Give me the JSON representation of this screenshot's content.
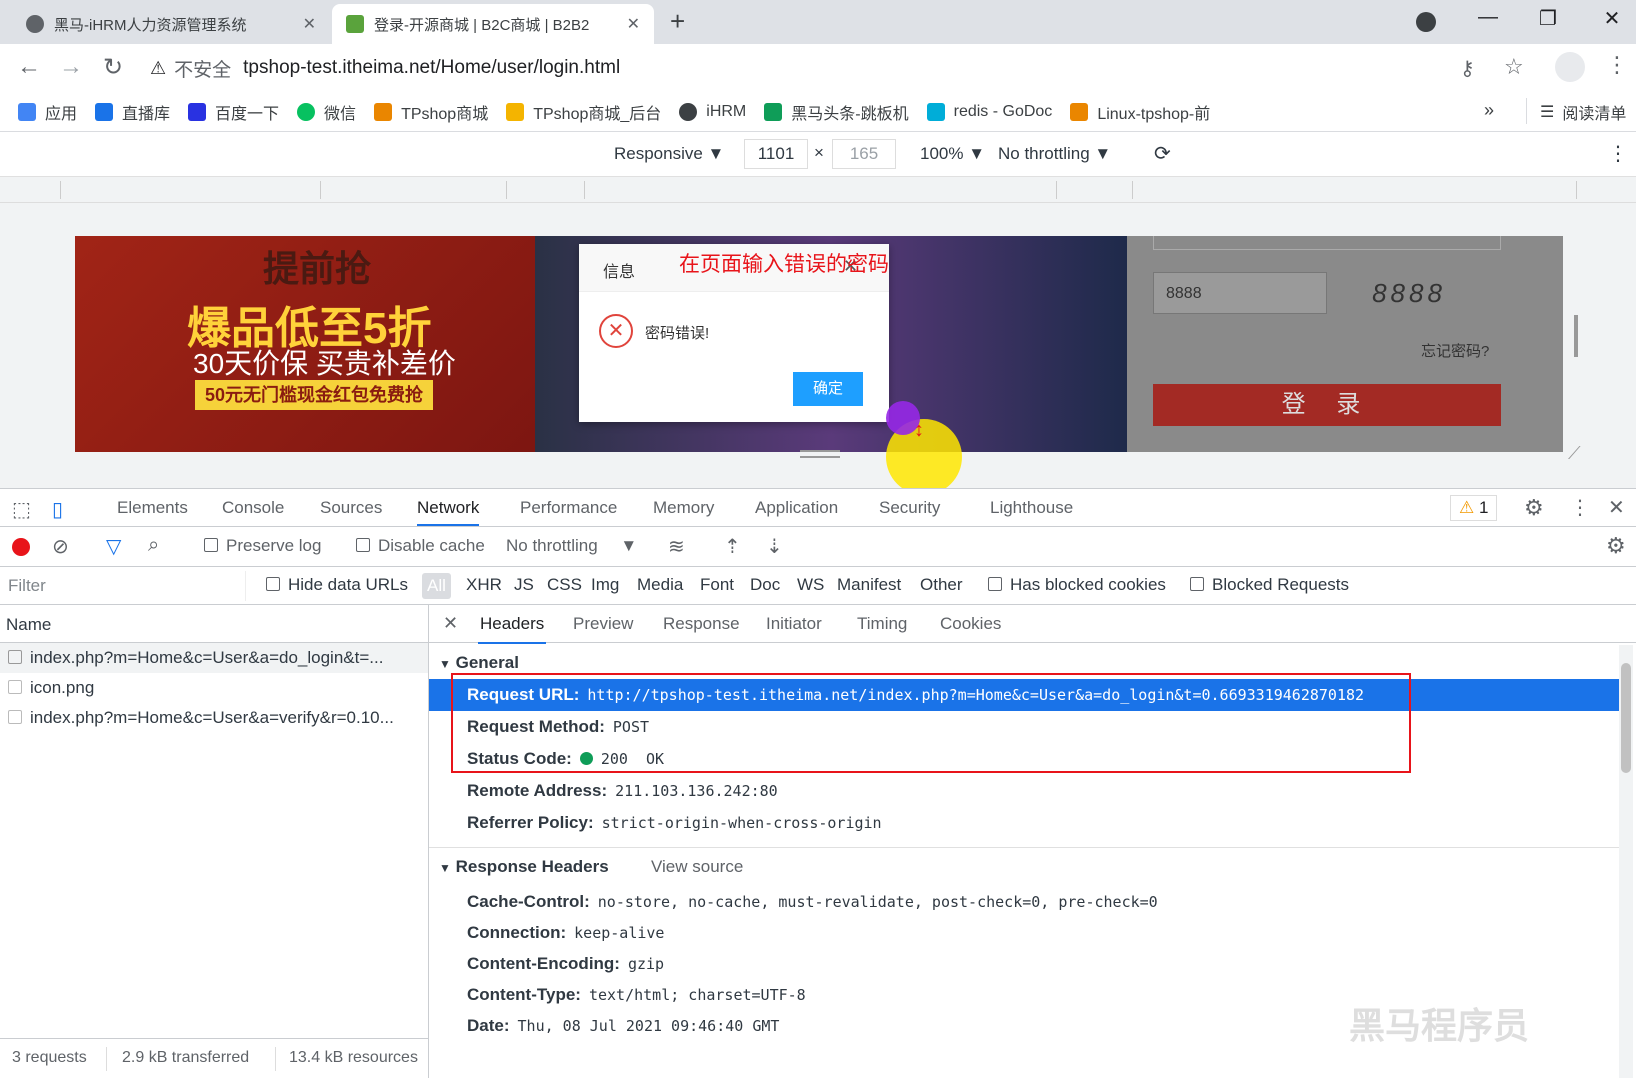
{
  "tabs": [
    {
      "title": "黑马-iHRM人力资源管理系统",
      "active": false
    },
    {
      "title": "登录-开源商城 | B2C商城 | B2B2",
      "active": true
    }
  ],
  "address": {
    "security_label": "不安全",
    "url": "tpshop-test.itheima.net/Home/user/login.html"
  },
  "bookmarks": [
    {
      "label": "应用",
      "color": "#4285f4"
    },
    {
      "label": "直播库",
      "color": "#1a73e8"
    },
    {
      "label": "百度一下",
      "color": "#2932e1"
    },
    {
      "label": "微信",
      "color": "#07c160"
    },
    {
      "label": "TPshop商城",
      "color": "#ea8600"
    },
    {
      "label": "TPshop商城_后台",
      "color": "#f4b400"
    },
    {
      "label": "iHRM",
      "color": "#3c4043"
    },
    {
      "label": "黑马头条-跳板机",
      "color": "#0f9d58"
    },
    {
      "label": "redis - GoDoc",
      "color": "#00add8"
    },
    {
      "label": "Linux-tpshop-前",
      "color": "#ea8600"
    }
  ],
  "bookmarks_more": "»",
  "reading_list": "阅读清单",
  "device": {
    "mode": "Responsive",
    "width": "1101",
    "height": "165",
    "zoom": "100%",
    "throttle": "No throttling"
  },
  "page": {
    "banner_line1": "提前抢",
    "banner_line2": "爆品低至5折",
    "banner_line3": "30天价保 买贵补差价",
    "banner_line4": "50元无门槛现金红包免费抢",
    "captcha_value": "8888",
    "captcha_image_text": "8888",
    "forgot": "忘记密码?",
    "login_button": "登 录",
    "dialog": {
      "title": "信息",
      "message": "密码错误!",
      "ok": "确定"
    },
    "annotation": "在页面输入错误的密码"
  },
  "devtools": {
    "tabs": [
      "Elements",
      "Console",
      "Sources",
      "Network",
      "Performance",
      "Memory",
      "Application",
      "Security",
      "Lighthouse"
    ],
    "active_tab": "Network",
    "warning_count": "1",
    "toolbar": {
      "preserve_log": "Preserve log",
      "disable_cache": "Disable cache",
      "throttle": "No throttling"
    },
    "filter": {
      "placeholder": "Filter",
      "hide_data_urls": "Hide data URLs",
      "types": [
        "All",
        "XHR",
        "JS",
        "CSS",
        "Img",
        "Media",
        "Font",
        "Doc",
        "WS",
        "Manifest",
        "Other"
      ],
      "has_blocked_cookies": "Has blocked cookies",
      "blocked_requests": "Blocked Requests"
    },
    "requests": {
      "header": "Name",
      "items": [
        "index.php?m=Home&c=User&a=do_login&t=...",
        "icon.png",
        "index.php?m=Home&c=User&a=verify&r=0.10..."
      ],
      "footer": {
        "count": "3 requests",
        "transferred": "2.9 kB transferred",
        "resources": "13.4 kB resources"
      }
    },
    "detail_tabs": [
      "Headers",
      "Preview",
      "Response",
      "Initiator",
      "Timing",
      "Cookies"
    ],
    "general": {
      "title": "General",
      "request_url_key": "Request URL:",
      "request_url": "http://tpshop-test.itheima.net/index.php?m=Home&c=User&a=do_login&t=0.6693319462870182",
      "method_key": "Request Method:",
      "method": "POST",
      "status_key": "Status Code:",
      "status": "200  OK",
      "remote_key": "Remote Address:",
      "remote": "211.103.136.242:80",
      "referrer_key": "Referrer Policy:",
      "referrer": "strict-origin-when-cross-origin"
    },
    "response_headers": {
      "title": "Response Headers",
      "view_source": "View source",
      "items": [
        {
          "k": "Cache-Control:",
          "v": "no-store, no-cache, must-revalidate, post-check=0, pre-check=0"
        },
        {
          "k": "Connection:",
          "v": "keep-alive"
        },
        {
          "k": "Content-Encoding:",
          "v": "gzip"
        },
        {
          "k": "Content-Type:",
          "v": "text/html; charset=UTF-8"
        },
        {
          "k": "Date:",
          "v": "Thu, 08 Jul 2021 09:46:40 GMT"
        }
      ]
    },
    "watermark": "黑马程序员"
  }
}
